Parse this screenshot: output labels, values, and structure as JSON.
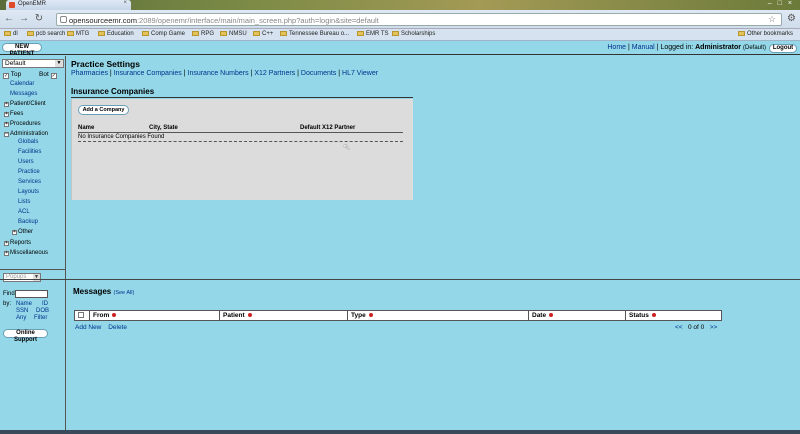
{
  "browser": {
    "tab_title": "OpenEMR",
    "url_host": "opensourceemr.com",
    "url_path": ":2089/openemr/interface/main/main_screen.php?auth=login&site=default",
    "bookmarks": [
      "dl",
      "pcb search",
      "MTG",
      "Education",
      "Comp Game",
      "RPG",
      "NMSU",
      "C++",
      "Tennessee Bureau o...",
      "EMR TS",
      "Scholarships"
    ],
    "other_bookmarks": "Other bookmarks"
  },
  "topbar": {
    "new_patient": "NEW PATIENT",
    "home": "Home",
    "manual": "Manual",
    "logged_in_label": "Logged in:",
    "user": "Administrator",
    "group": "(Default)",
    "logout": "Logout"
  },
  "leftnav": {
    "mode": "Default",
    "top_label": "Top",
    "bot_label": "Bot",
    "items": {
      "calendar": "Calendar",
      "messages": "Messages",
      "patient_client": "Patient/Client",
      "fees": "Fees",
      "procedures": "Procedures",
      "administration": "Administration",
      "globals": "Globals",
      "facilities": "Facilities",
      "users": "Users",
      "practice": "Practice",
      "services": "Services",
      "layouts": "Layouts",
      "lists": "Lists",
      "acl": "ACL",
      "backup": "Backup",
      "other": "Other",
      "reports": "Reports",
      "miscellaneous": "Miscellaneous"
    },
    "popups": "Popups",
    "find_label": "Find:",
    "by_label": "by:",
    "find_options": [
      "Name",
      "ID",
      "SSN",
      "DOB",
      "Any",
      "Filter"
    ],
    "online_support": "Online Support"
  },
  "main": {
    "title": "Practice Settings",
    "links": [
      "Pharmacies",
      "Insurance Companies",
      "Insurance Numbers",
      "X12 Partners",
      "Documents",
      "HL7 Viewer"
    ],
    "section_title": "Insurance Companies",
    "add_company": "Add a Company",
    "columns": [
      "Name",
      "City, State",
      "Default X12 Partner"
    ],
    "empty_text": "No Insurance Companies Found"
  },
  "messages": {
    "title": "Messages",
    "see_all": "(See All)",
    "columns": [
      "From",
      "Patient",
      "Type",
      "Date",
      "Status"
    ],
    "add_new": "Add New",
    "delete": "Delete",
    "pager_prev": "<<",
    "pager_text": "0 of 0",
    "pager_next": ">>"
  }
}
